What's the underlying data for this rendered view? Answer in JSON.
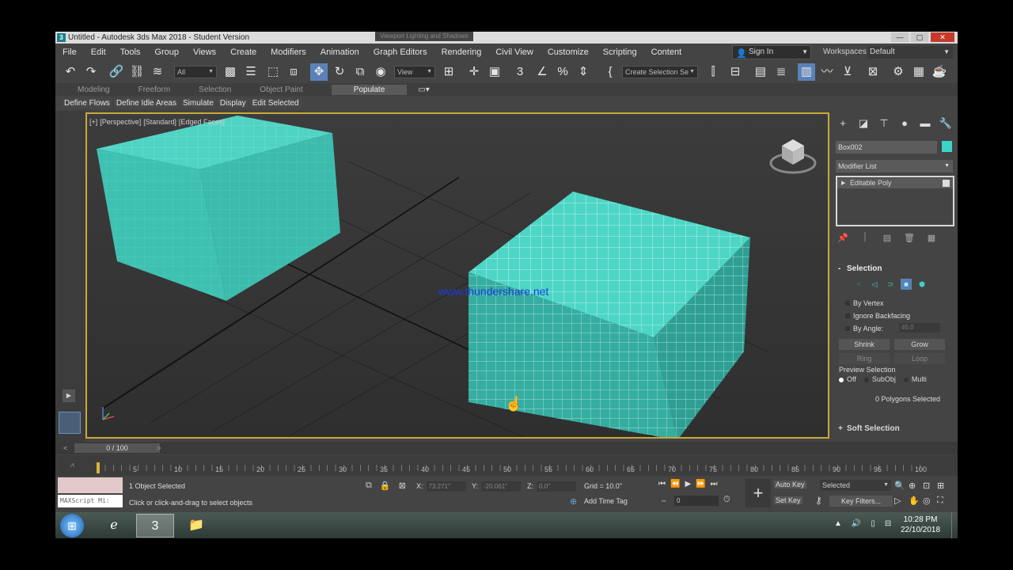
{
  "window": {
    "title": "Untitled - Autodesk 3ds Max 2018 - Student Version",
    "app_icon": "3",
    "viewport_hint": "Viewport Lighting and Shadows"
  },
  "menu": [
    "File",
    "Edit",
    "Tools",
    "Group",
    "Views",
    "Create",
    "Modifiers",
    "Animation",
    "Graph Editors",
    "Rendering",
    "Civil View",
    "Customize",
    "Scripting",
    "Content"
  ],
  "account": {
    "sign_in": "Sign In",
    "workspaces_label": "Workspaces:",
    "workspace": "Default"
  },
  "toolbar": {
    "filter": "All",
    "ref_coord": "View",
    "selection_set": "Create Selection Se"
  },
  "ribbon": {
    "tabs": [
      "Modeling",
      "Freeform",
      "Selection",
      "Object Paint",
      "Populate"
    ],
    "active_tab": "Populate",
    "buttons": [
      "Define Flows",
      "Define Idle Areas",
      "Simulate",
      "Display",
      "Edit Selected"
    ]
  },
  "viewport": {
    "label_parts": [
      "[+]",
      "[Perspective]",
      "[Standard]",
      "[Edged Faces]"
    ],
    "watermark": "www.thundershare.net"
  },
  "command_panel": {
    "object_name": "Box002",
    "object_color": "#3cd5c7",
    "modifier_list": "Modifier List",
    "stack_item": "Editable Poly",
    "selection": {
      "title": "Selection",
      "by_vertex": "By Vertex",
      "ignore_backfacing": "Ignore Backfacing",
      "by_angle": "By Angle:",
      "angle_value": "45.0",
      "shrink": "Shrink",
      "grow": "Grow",
      "ring": "Ring",
      "loop": "Loop",
      "preview_label": "Preview Selection",
      "preview_off": "Off",
      "preview_subobj": "SubObj",
      "preview_multi": "Multi",
      "poly_count": "0 Polygons Selected"
    },
    "soft_selection": "Soft Selection"
  },
  "timeline": {
    "slider": "0 / 100",
    "ticks": [
      "0",
      "5",
      "10",
      "15",
      "20",
      "25",
      "30",
      "35",
      "40",
      "45",
      "50",
      "55",
      "60",
      "65",
      "70",
      "75",
      "80",
      "85",
      "90",
      "95",
      "100"
    ]
  },
  "status": {
    "maxscript": "MAXScript Mi:",
    "line1": "1 Object Selected",
    "line2": "Click or click-and-drag to select objects",
    "x_label": "X:",
    "x_value": "73.271\"",
    "y_label": "Y:",
    "y_value": "-20.061\"",
    "z_label": "Z:",
    "z_value": "0.0\"",
    "grid": "Grid = 10.0\"",
    "add_time_tag": "Add Time Tag",
    "frame": "0",
    "auto_key": "Auto Key",
    "set_key": "Set Key",
    "selected": "Selected",
    "key_filters": "Key Filters..."
  },
  "taskbar": {
    "clock_time": "10:28 PM",
    "clock_date": "22/10/2018"
  },
  "colors": {
    "viewport_border": "#c9a93a",
    "mesh": "#40c8b8",
    "active_tool": "#5a82b8"
  }
}
